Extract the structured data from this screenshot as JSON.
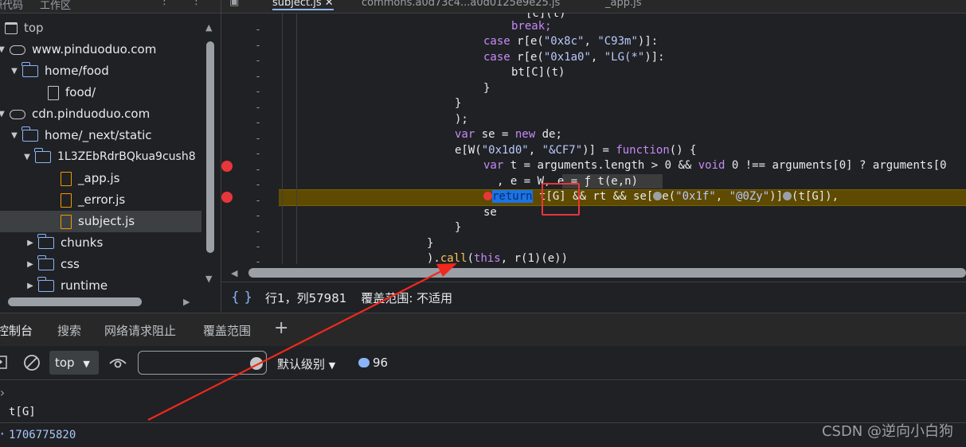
{
  "tree": {
    "tabs": [
      "源代码",
      "工作区"
    ],
    "nodes": [
      {
        "label": "top",
        "icon": "frame-icon"
      },
      {
        "label": "www.pinduoduo.com",
        "icon": "cloud-icon"
      },
      {
        "label": "home/food",
        "icon": "folder-icon"
      },
      {
        "label": "food/",
        "icon": "file-icon"
      },
      {
        "label": "cdn.pinduoduo.com",
        "icon": "cloud-icon"
      },
      {
        "label": "home/_next/static",
        "icon": "folder-icon"
      },
      {
        "label": "1L3ZEbRdrBQkua9cush8",
        "icon": "folder-icon"
      },
      {
        "label": "_app.js",
        "icon": "js-file-icon"
      },
      {
        "label": "_error.js",
        "icon": "js-file-icon"
      },
      {
        "label": "subject.js",
        "icon": "js-file-icon"
      },
      {
        "label": "chunks",
        "icon": "folder-icon"
      },
      {
        "label": "css",
        "icon": "folder-icon"
      },
      {
        "label": "runtime",
        "icon": "folder-icon"
      }
    ]
  },
  "editor": {
    "tabs": [
      "subject.js",
      "commons.a0d73c4...a0d0125e9e25.js",
      "_app.js"
    ],
    "code": {
      "l0": "[c](t)",
      "l1": "break;",
      "l2a": "case",
      "l2b": " r[e(",
      "l2c": "\"0x8c\"",
      "l2d": ", ",
      "l2e": "\"C93m\"",
      "l2f": ")]:",
      "l3a": "case",
      "l3b": " r[e(",
      "l3c": "\"0x1a0\"",
      "l3d": ", ",
      "l3e": "\"LG(*\"",
      "l3f": ")]:",
      "l4": "bt[C](t)",
      "l5": "}",
      "l6": "}",
      "l7": ");",
      "l8a": "var",
      "l8b": " se = ",
      "l8c": "new",
      "l8d": " de;",
      "l9a": "e[W(",
      "l9b": "\"0x1d0\"",
      "l9c": ", ",
      "l9d": "\"&CF7\"",
      "l9e": ")] = ",
      "l9f": "function",
      "l9g": "() {",
      "l10a": "var",
      "l10b": " t = arguments.length > 0 && ",
      "l10c": "void",
      "l10d": " 0 !== arguments[0] ? arguments[0",
      "l11a": ", e = W, ",
      "l11b": "e = ƒ t(e,n)",
      "l12a": "return",
      "l12b": " t[G] && rt && se[",
      "l12c": "e(",
      "l12d": "\"0x1f\"",
      "l12e": ", ",
      "l12f": "\"@0Zy\"",
      "l12g": ")]",
      "l12h": "(t[G]),",
      "l13": "se",
      "l14": "}",
      "l15": "}",
      "l16a": ").",
      "l16b": "call",
      "l16c": "(",
      "l16d": "this",
      "l16e": ", r(1)(e))"
    },
    "status": {
      "braces": "{ }",
      "position": "行1，列57981",
      "coverage": "覆盖范围: 不适用"
    }
  },
  "drawer": {
    "tabs": [
      "控制台",
      "搜索",
      "网络请求阻止",
      "覆盖范围"
    ],
    "add": "+",
    "context": "top",
    "filter_value": "",
    "level": "默认级别",
    "count": "96",
    "input": "t[G]",
    "output": "1706775820",
    "prompt_in": "›",
    "prompt_out": "·"
  },
  "watermark": "CSDN @逆向小白狗"
}
